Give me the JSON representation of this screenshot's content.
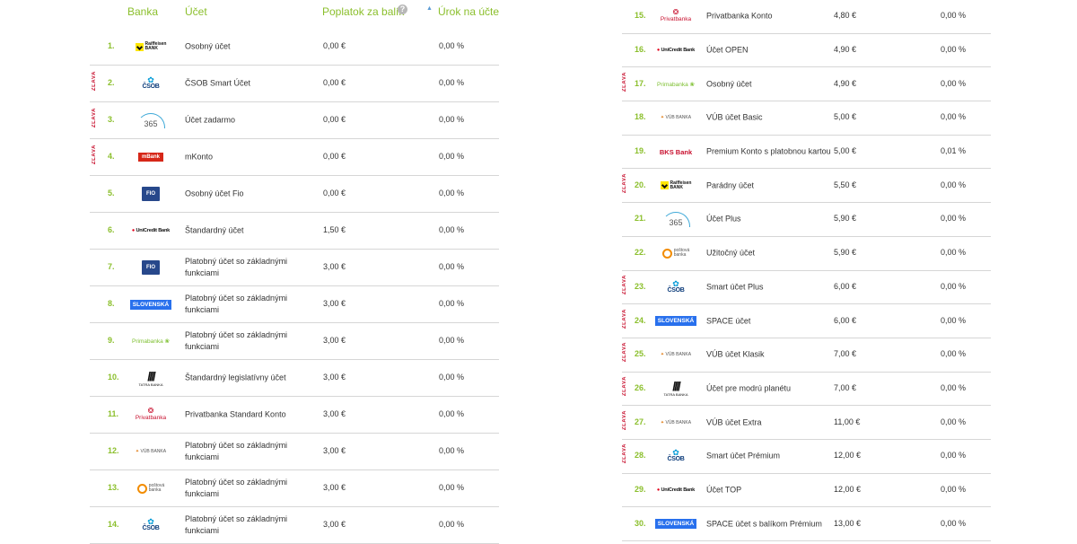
{
  "header": {
    "banka": "Banka",
    "ucet": "Účet",
    "poplatok": "Poplatok za balík",
    "help_glyph": "?",
    "sort_glyph": "▲",
    "urok": "Úrok na účte"
  },
  "zlava_label": "ZĽAVA",
  "brand_colors": {
    "accent": "#8bbf2c",
    "zlava": "#c8102e",
    "divider": "#d6d6d6"
  },
  "left_rows": [
    {
      "rank": "1.",
      "bank": "raiffeisen",
      "logo_lines": [
        "Raiffeisen",
        "BANK"
      ],
      "account": "Osobný účet",
      "fee": "0,00 €",
      "rate": "0,00 %",
      "zlava": false
    },
    {
      "rank": "2.",
      "bank": "csob",
      "logo_lines": [
        "ČSOB"
      ],
      "account": "ČSOB Smart Účet",
      "fee": "0,00 €",
      "rate": "0,00 %",
      "zlava": true
    },
    {
      "rank": "3.",
      "bank": "365",
      "logo_lines": [
        "365"
      ],
      "account": "Účet zadarmo",
      "fee": "0,00 €",
      "rate": "0,00 %",
      "zlava": true
    },
    {
      "rank": "4.",
      "bank": "mbank",
      "logo_lines": [
        "mBank"
      ],
      "account": "mKonto",
      "fee": "0,00 €",
      "rate": "0,00 %",
      "zlava": true
    },
    {
      "rank": "5.",
      "bank": "fio",
      "logo_lines": [
        "FIO"
      ],
      "account": "Osobný účet Fio",
      "fee": "0,00 €",
      "rate": "0,00 %",
      "zlava": false
    },
    {
      "rank": "6.",
      "bank": "unicredit",
      "logo_lines": [
        "UniCredit Bank"
      ],
      "account": "Štandardný účet",
      "fee": "1,50 €",
      "rate": "0,00 %",
      "zlava": false
    },
    {
      "rank": "7.",
      "bank": "fio",
      "logo_lines": [
        "FIO"
      ],
      "account": "Platobný účet so základnými funkciami",
      "fee": "3,00 €",
      "rate": "0,00 %",
      "zlava": false
    },
    {
      "rank": "8.",
      "bank": "slsp",
      "logo_lines": [
        "SLOVENSKÁ"
      ],
      "account": "Platobný účet so základnými funkciami",
      "fee": "3,00 €",
      "rate": "0,00 %",
      "zlava": false
    },
    {
      "rank": "9.",
      "bank": "prima",
      "logo_lines": [
        "Primabanka"
      ],
      "account": "Platobný účet so základnými funkciami",
      "fee": "3,00 €",
      "rate": "0,00 %",
      "zlava": false
    },
    {
      "rank": "10.",
      "bank": "tatra",
      "logo_lines": [
        "TATRA BANKA"
      ],
      "account": "Štandardný legislatívny účet",
      "fee": "3,00 €",
      "rate": "0,00 %",
      "zlava": false
    },
    {
      "rank": "11.",
      "bank": "privatbanka",
      "logo_lines": [
        "Privatbanka"
      ],
      "account": "Privatbanka Standard Konto",
      "fee": "3,00 €",
      "rate": "0,00 %",
      "zlava": false
    },
    {
      "rank": "12.",
      "bank": "vub",
      "logo_lines": [
        "VÚB BANKA"
      ],
      "account": "Platobný účet so základnými funkciami",
      "fee": "3,00 €",
      "rate": "0,00 %",
      "zlava": false
    },
    {
      "rank": "13.",
      "bank": "posta",
      "logo_lines": [
        "poštová",
        "banka"
      ],
      "account": "Platobný účet so základnými funkciami",
      "fee": "3,00 €",
      "rate": "0,00 %",
      "zlava": false
    },
    {
      "rank": "14.",
      "bank": "csob",
      "logo_lines": [
        "ČSOB"
      ],
      "account": "Platobný účet so základnými funkciami",
      "fee": "3,00 €",
      "rate": "0,00 %",
      "zlava": false
    }
  ],
  "right_rows": [
    {
      "rank": "15.",
      "bank": "privatbanka",
      "logo_lines": [
        "Privatbanka"
      ],
      "account": "Privatbanka Konto",
      "fee": "4,80 €",
      "rate": "0,00 %",
      "zlava": false
    },
    {
      "rank": "16.",
      "bank": "unicredit",
      "logo_lines": [
        "UniCredit Bank"
      ],
      "account": "Účet OPEN",
      "fee": "4,90 €",
      "rate": "0,00 %",
      "zlava": false
    },
    {
      "rank": "17.",
      "bank": "prima",
      "logo_lines": [
        "Primabanka"
      ],
      "account": "Osobný účet",
      "fee": "4,90 €",
      "rate": "0,00 %",
      "zlava": true
    },
    {
      "rank": "18.",
      "bank": "vub",
      "logo_lines": [
        "VÚB BANKA"
      ],
      "account": "VÚB účet Basic",
      "fee": "5,00 €",
      "rate": "0,00 %",
      "zlava": false
    },
    {
      "rank": "19.",
      "bank": "bks",
      "logo_lines": [
        "BKS Bank"
      ],
      "account": "Premium Konto s platobnou kartou",
      "fee": "5,00 €",
      "rate": "0,01 %",
      "zlava": false
    },
    {
      "rank": "20.",
      "bank": "raiffeisen",
      "logo_lines": [
        "Raiffeisen",
        "BANK"
      ],
      "account": "Parádny účet",
      "fee": "5,50 €",
      "rate": "0,00 %",
      "zlava": true
    },
    {
      "rank": "21.",
      "bank": "365",
      "logo_lines": [
        "365"
      ],
      "account": "Účet Plus",
      "fee": "5,90 €",
      "rate": "0,00 %",
      "zlava": false
    },
    {
      "rank": "22.",
      "bank": "posta",
      "logo_lines": [
        "poštová",
        "banka"
      ],
      "account": "Užitočný účet",
      "fee": "5,90 €",
      "rate": "0,00 %",
      "zlava": false
    },
    {
      "rank": "23.",
      "bank": "csob",
      "logo_lines": [
        "ČSOB"
      ],
      "account": "Smart účet Plus",
      "fee": "6,00 €",
      "rate": "0,00 %",
      "zlava": true
    },
    {
      "rank": "24.",
      "bank": "slsp",
      "logo_lines": [
        "SLOVENSKÁ"
      ],
      "account": "SPACE účet",
      "fee": "6,00 €",
      "rate": "0,00 %",
      "zlava": true
    },
    {
      "rank": "25.",
      "bank": "vub",
      "logo_lines": [
        "VÚB BANKA"
      ],
      "account": "VÚB účet Klasik",
      "fee": "7,00 €",
      "rate": "0,00 %",
      "zlava": true
    },
    {
      "rank": "26.",
      "bank": "tatra",
      "logo_lines": [
        "TATRA BANKA"
      ],
      "account": "Účet pre modrú planétu",
      "fee": "7,00 €",
      "rate": "0,00 %",
      "zlava": true
    },
    {
      "rank": "27.",
      "bank": "vub",
      "logo_lines": [
        "VÚB BANKA"
      ],
      "account": "VÚB účet Extra",
      "fee": "11,00 €",
      "rate": "0,00 %",
      "zlava": true
    },
    {
      "rank": "28.",
      "bank": "csob",
      "logo_lines": [
        "ČSOB"
      ],
      "account": "Smart účet Prémium",
      "fee": "12,00 €",
      "rate": "0,00 %",
      "zlava": true
    },
    {
      "rank": "29.",
      "bank": "unicredit",
      "logo_lines": [
        "UniCredit Bank"
      ],
      "account": "Účet TOP",
      "fee": "12,00 €",
      "rate": "0,00 %",
      "zlava": false
    },
    {
      "rank": "30.",
      "bank": "slsp",
      "logo_lines": [
        "SLOVENSKÁ"
      ],
      "account": "SPACE účet s balíkom Prémium",
      "fee": "13,00 €",
      "rate": "0,00 %",
      "zlava": false
    }
  ]
}
